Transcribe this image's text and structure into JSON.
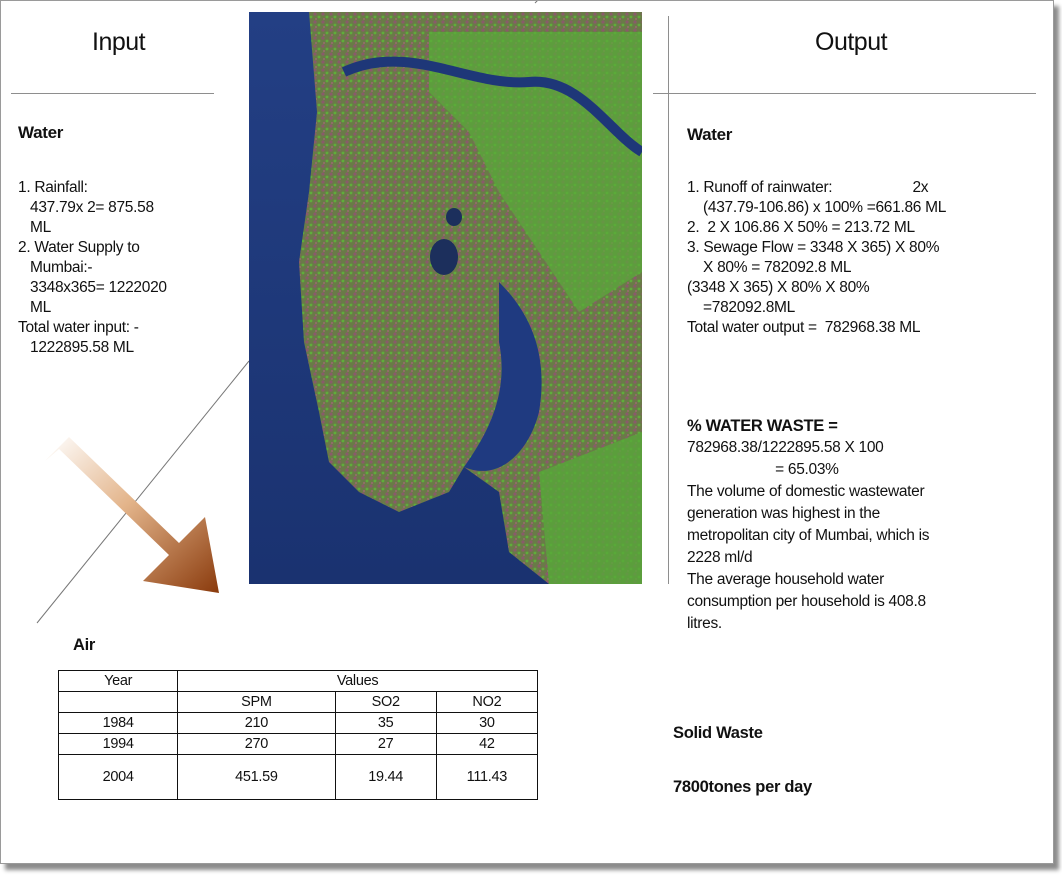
{
  "input": {
    "title": "Input",
    "water": {
      "heading": "Water",
      "lines": [
        "1. Rainfall:",
        "   437.79x 2= 875.58",
        "   ML",
        "2. Water Supply to",
        "   Mumbai:-",
        "   3348x365= 1222020",
        "   ML",
        "Total water input: -",
        "   1222895.58 ML"
      ]
    }
  },
  "output": {
    "title": "Output",
    "water": {
      "heading": "Water",
      "lines": [
        "1. Runoff of rainwater:                    2x",
        "    (437.79-106.86) x 100% =661.86 ML",
        "2.  2 X 106.86 X 50% = 213.72 ML",
        "3. Sewage Flow = 3348 X 365) X 80%",
        "    X 80% = 782092.8 ML",
        "(3348 X 365) X 80% X 80%",
        "    =782092.8ML",
        "Total water output =  782968.38 ML"
      ]
    },
    "waste": {
      "heading": "% WATER WASTE =",
      "lines": [
        "782968.38/1222895.58 X 100",
        "                      = 65.03%",
        "The volume of domestic wastewater",
        "generation was highest in the",
        "metropolitan city of Mumbai, which is",
        "2228 ml/d",
        "The average household water",
        "consumption per household is 408.8",
        "litres."
      ]
    },
    "solid_waste": {
      "heading": "Solid Waste",
      "value": "7800tones per day"
    }
  },
  "air": {
    "heading": "Air",
    "table": {
      "year_header": "Year",
      "values_header": "Values",
      "columns": [
        "SPM",
        "SO2",
        "NO2"
      ],
      "rows": [
        {
          "year": "1984",
          "values": [
            "210",
            "35",
            "30"
          ]
        },
        {
          "year": "1994",
          "values": [
            "270",
            "27",
            "42"
          ]
        },
        {
          "year": "2004",
          "values": [
            "451.59",
            "19.44",
            "111.43"
          ]
        }
      ]
    }
  },
  "colors": {
    "sea": "#1a3a7a",
    "vegetation": "#5fae3a",
    "urban": "#7a5a62",
    "arrow": "#b0561c"
  },
  "icons": {
    "map": "satellite-map-mumbai",
    "arrow": "diagonal-arrow-down-right"
  }
}
